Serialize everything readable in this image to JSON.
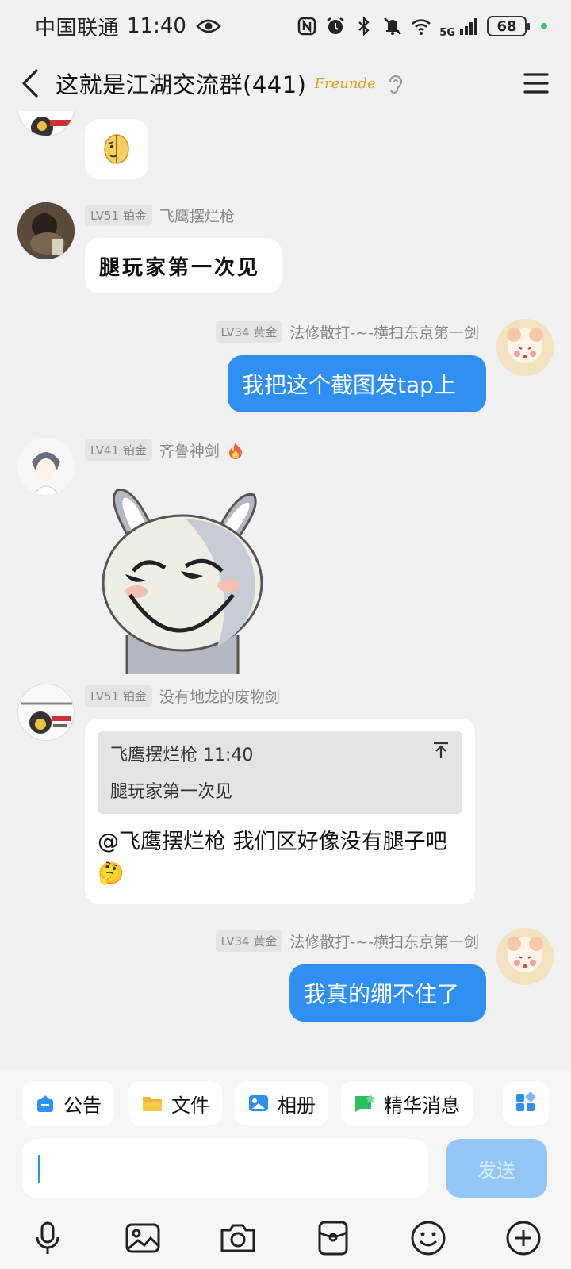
{
  "status": {
    "carrier": "中国联通",
    "time": "11:40",
    "network": "5G",
    "battery": "68"
  },
  "header": {
    "title": "这就是江湖交流群(441)",
    "brand": "Freunde"
  },
  "messages": [
    {
      "badge": "LV51 铂金",
      "name": "飞鹰摆烂枪",
      "text": "腿玩家第一次见"
    },
    {
      "badge": "LV34 黄金",
      "name": "法修散打-~-横扫东京第一剑",
      "text": "我把这个截图发tap上"
    },
    {
      "badge": "LV41 铂金",
      "name": "齐鲁神剑"
    },
    {
      "badge": "LV51 铂金",
      "name": "没有地龙的废物剑",
      "quote_header": "飞鹰摆烂枪 11:40",
      "quote_text": "腿玩家第一次见",
      "text": "@飞鹰摆烂枪 我们区好像没有腿子吧🤔"
    },
    {
      "badge": "LV34 黄金",
      "name": "法修散打-~-横扫东京第一剑",
      "text": "我真的绷不住了"
    }
  ],
  "quick_actions": [
    "公告",
    "文件",
    "相册",
    "精华消息"
  ],
  "input": {
    "send_label": "发送"
  },
  "colors": {
    "accent": "#2f8ff2",
    "send_disabled": "#94c7f5"
  }
}
